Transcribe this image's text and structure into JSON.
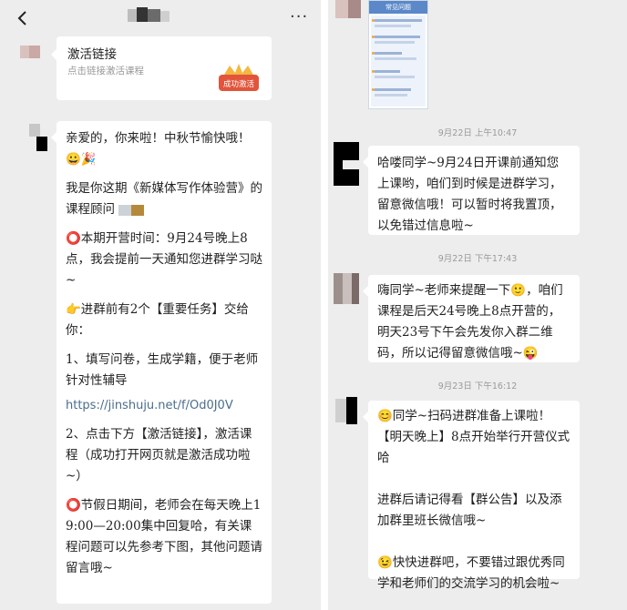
{
  "left_chat": {
    "back_icon": "chevron-left-icon",
    "more_label": "···",
    "link_card": {
      "title": "激活链接",
      "description": "点击链接激活课程",
      "badge_label": "成功激活"
    },
    "message": {
      "p1": "亲爱的，你来啦！中秋节愉快哦！😀🎉",
      "p2": "我是你这期《新媒体写作体验营》的课程顾问",
      "p3": "⭕本期开营时间：9月24号晚上8点，我会提前一天通知您进群学习哒~",
      "p4": "👉进群前有2个【重要任务】交给你：",
      "p5": "1、填写问卷，生成学籍，便于老师针对性辅导",
      "link": "https://jinshuju.net/f/Od0J0V",
      "p6": "2、点击下方【激活链接】，激活课程（成功打开网页就是激活成功啦~）",
      "p7": "⭕节假日期间，老师会在每天晚上19:00—20:00集中回复哈，有关课程问题可以先参考下图，其他问题请留言哦~"
    }
  },
  "right_chat": {
    "thumbnail": {
      "title": "常见问题"
    },
    "timestamps": [
      "9月22日 上午10:47",
      "9月22日 下午17:43",
      "9月23日 下午16:12"
    ],
    "messages": [
      "哈喽同学~9月24日开课前通知您上课哟，咱们到时候是进群学习，留意微信哦！可以暂时将我置顶，以免错过信息啦~",
      "嗨同学~老师来提醒一下🙂，咱们课程是后天24号晚上8点开营的，明天23号下午会先发你入群二维码，所以记得留意微信哦~😜",
      "😊同学~扫码进群准备上课啦！【明天晚上】8点开始举行开营仪式哈\n\n进群后请记得看【群公告】以及添加群里班长微信哦~\n\n😉快快进群吧，不要错过跟优秀同学和老师们的交流学习的机会啦~"
    ]
  },
  "colors": {
    "chat_background": "#ededed",
    "bubble": "#ffffff",
    "link": "#4a6d8c",
    "timestamp": "#9a9a9a",
    "badge": "#e2543b"
  }
}
